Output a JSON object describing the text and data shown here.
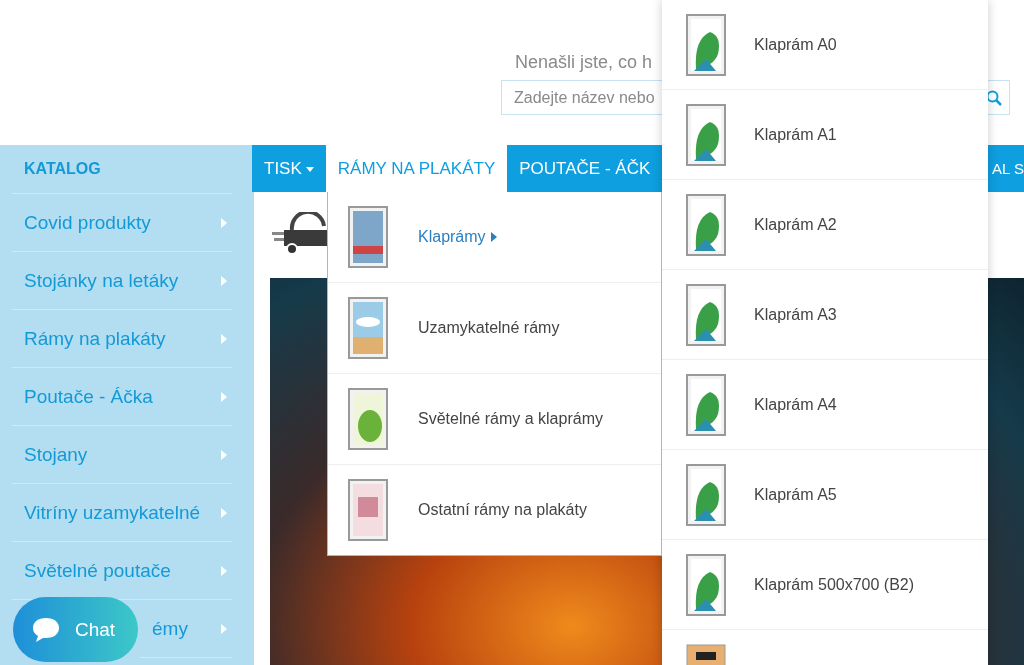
{
  "header": {
    "prompt": "Nenašli jste, co h",
    "search": {
      "placeholder": "Zadejte název nebo"
    }
  },
  "sidebar": {
    "title": "KATALOG",
    "items": [
      {
        "label": "Covid produkty"
      },
      {
        "label": "Stojánky na letáky"
      },
      {
        "label": "Rámy na plakáty"
      },
      {
        "label": "Poutače - Áčka"
      },
      {
        "label": "Stojany"
      },
      {
        "label": "Vitríny uzamykatelné"
      },
      {
        "label": "Světelné poutače"
      },
      {
        "label": "émy"
      }
    ]
  },
  "nav": {
    "tabs": [
      {
        "label": "TISK",
        "selected": false,
        "dropdown": true
      },
      {
        "label": "RÁMY NA PLAKÁTY",
        "selected": true,
        "dropdown": false
      },
      {
        "label": "POUTAČE - ÁČK",
        "selected": false,
        "dropdown": false
      },
      {
        "label": "AL S",
        "selected": false,
        "dropdown": false
      }
    ]
  },
  "menu": {
    "items": [
      {
        "label": "Klaprámy",
        "selected": true,
        "submenu": true
      },
      {
        "label": "Uzamykatelné rámy",
        "selected": false,
        "submenu": false
      },
      {
        "label": "Světelné rámy a klaprámy",
        "selected": false,
        "submenu": false
      },
      {
        "label": "Ostatní rámy na plakáty",
        "selected": false,
        "submenu": false
      }
    ]
  },
  "submenu": {
    "items": [
      {
        "label": "Klaprám A0"
      },
      {
        "label": "Klaprám A1"
      },
      {
        "label": "Klaprám A2"
      },
      {
        "label": "Klaprám A3"
      },
      {
        "label": "Klaprám A4"
      },
      {
        "label": "Klaprám A5"
      },
      {
        "label": "Klaprám 500x700 (B2)"
      }
    ]
  },
  "chat": {
    "label": "Chat"
  }
}
